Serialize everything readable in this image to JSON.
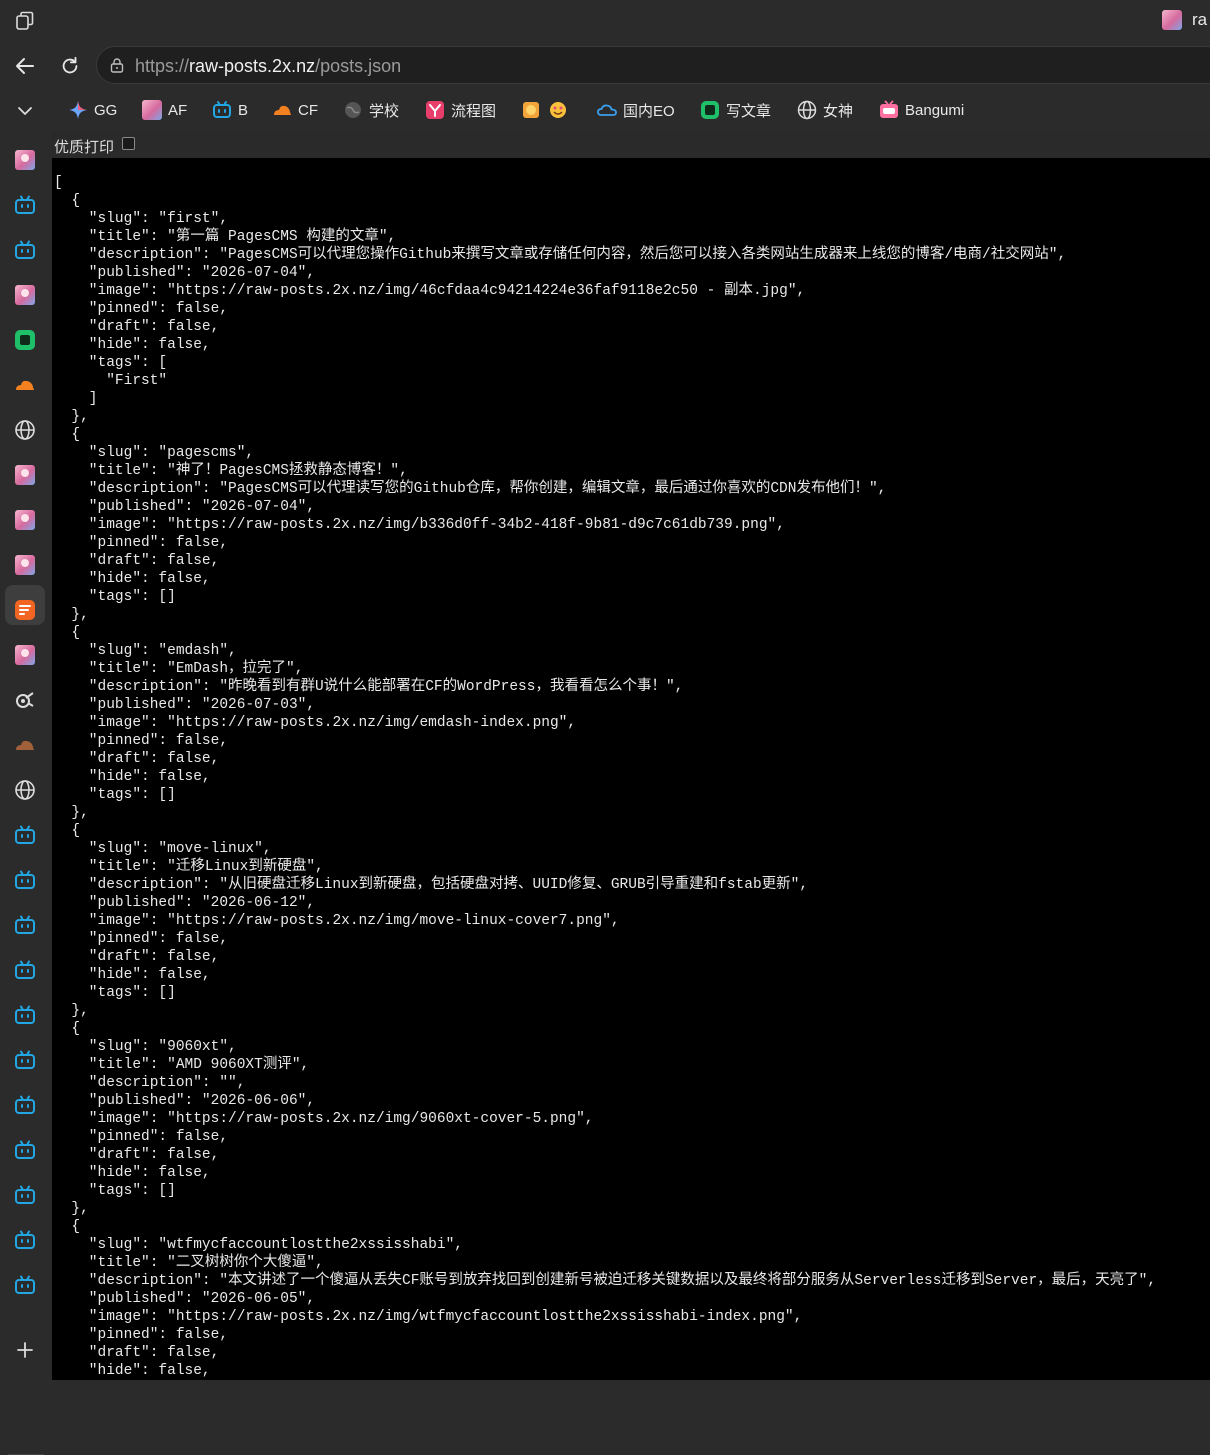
{
  "browser": {
    "tab_title": "ra",
    "url_scheme": "https://",
    "url_host": "raw-posts.2x.nz",
    "url_path": "/posts.json"
  },
  "bookmarks": [
    {
      "label": "GG",
      "icon": "gemini-icon",
      "color": "#6aa6ff"
    },
    {
      "label": "AF",
      "icon": "anime-avatar-icon",
      "color": "#e48bb4"
    },
    {
      "label": "B",
      "icon": "bilibili-icon",
      "color": "#22a7e4"
    },
    {
      "label": "CF",
      "icon": "cloudflare-icon",
      "color": "#f48120"
    },
    {
      "label": "学校",
      "icon": "globe-gray-icon",
      "color": "#9a9a9a"
    },
    {
      "label": "流程图",
      "icon": "flowchart-icon",
      "color": "#e83e6b"
    },
    {
      "label": "",
      "icon": "emoji-icon",
      "color": "#f0b030"
    },
    {
      "label": "国内EO",
      "icon": "cloud-icon",
      "color": "#3aa0f0"
    },
    {
      "label": "写文章",
      "icon": "note-icon",
      "color": "#1fbf6a"
    },
    {
      "label": "女神",
      "icon": "globe-icon",
      "color": "#dcdcdc"
    },
    {
      "label": "Bangumi",
      "icon": "tv-icon",
      "color": "#ff6fa0"
    }
  ],
  "sidebar": [
    "anime-avatar-icon",
    "bilibili-icon",
    "bilibili-icon",
    "anime-avatar-icon",
    "note-icon",
    "cloudflare-icon",
    "globe-icon",
    "anime-avatar-icon",
    "anime-avatar-icon",
    "anime-avatar-icon",
    "feed-icon",
    "anime-avatar-icon",
    "graph-icon",
    "cloudflare-dim-icon",
    "globe-icon",
    "bilibili-icon",
    "bilibili-icon",
    "bilibili-icon",
    "bilibili-icon",
    "bilibili-icon",
    "bilibili-icon",
    "bilibili-icon",
    "bilibili-icon",
    "bilibili-icon",
    "bilibili-icon",
    "bilibili-icon"
  ],
  "pretty_print_label": "优质打印",
  "json_text": "[\n  {\n    \"slug\": \"first\",\n    \"title\": \"第一篇 PagesCMS 构建的文章\",\n    \"description\": \"PagesCMS可以代理您操作Github来撰写文章或存储任何内容，然后您可以接入各类网站生成器来上线您的博客/电商/社交网站\",\n    \"published\": \"2026-07-04\",\n    \"image\": \"https://raw-posts.2x.nz/img/46cfdaa4c94214224e36faf9118e2c50 - 副本.jpg\",\n    \"pinned\": false,\n    \"draft\": false,\n    \"hide\": false,\n    \"tags\": [\n      \"First\"\n    ]\n  },\n  {\n    \"slug\": \"pagescms\",\n    \"title\": \"神了！PagesCMS拯救静态博客！\",\n    \"description\": \"PagesCMS可以代理读写您的Github仓库，帮你创建，编辑文章，最后通过你喜欢的CDN发布他们！\",\n    \"published\": \"2026-07-04\",\n    \"image\": \"https://raw-posts.2x.nz/img/b336d0ff-34b2-418f-9b81-d9c7c61db739.png\",\n    \"pinned\": false,\n    \"draft\": false,\n    \"hide\": false,\n    \"tags\": []\n  },\n  {\n    \"slug\": \"emdash\",\n    \"title\": \"EmDash，拉完了\",\n    \"description\": \"昨晚看到有群U说什么能部署在CF的WordPress，我看看怎么个事！\",\n    \"published\": \"2026-07-03\",\n    \"image\": \"https://raw-posts.2x.nz/img/emdash-index.png\",\n    \"pinned\": false,\n    \"draft\": false,\n    \"hide\": false,\n    \"tags\": []\n  },\n  {\n    \"slug\": \"move-linux\",\n    \"title\": \"迁移Linux到新硬盘\",\n    \"description\": \"从旧硬盘迁移Linux到新硬盘，包括硬盘对拷、UUID修复、GRUB引导重建和fstab更新\",\n    \"published\": \"2026-06-12\",\n    \"image\": \"https://raw-posts.2x.nz/img/move-linux-cover7.png\",\n    \"pinned\": false,\n    \"draft\": false,\n    \"hide\": false,\n    \"tags\": []\n  },\n  {\n    \"slug\": \"9060xt\",\n    \"title\": \"AMD 9060XT测评\",\n    \"description\": \"\",\n    \"published\": \"2026-06-06\",\n    \"image\": \"https://raw-posts.2x.nz/img/9060xt-cover-5.png\",\n    \"pinned\": false,\n    \"draft\": false,\n    \"hide\": false,\n    \"tags\": []\n  },\n  {\n    \"slug\": \"wtfmycfaccountlostthe2xssisshabi\",\n    \"title\": \"二叉树树你个大傻逼\",\n    \"description\": \"本文讲述了一个傻逼从丢失CF账号到放弃找回到创建新号被迫迁移关键数据以及最终将部分服务从Serverless迁移到Server，最后，天亮了\",\n    \"published\": \"2026-06-05\",\n    \"image\": \"https://raw-posts.2x.nz/img/wtfmycfaccountlostthe2xssisshabi-index.png\",\n    \"pinned\": false,\n    \"draft\": false,\n    \"hide\": false,"
}
